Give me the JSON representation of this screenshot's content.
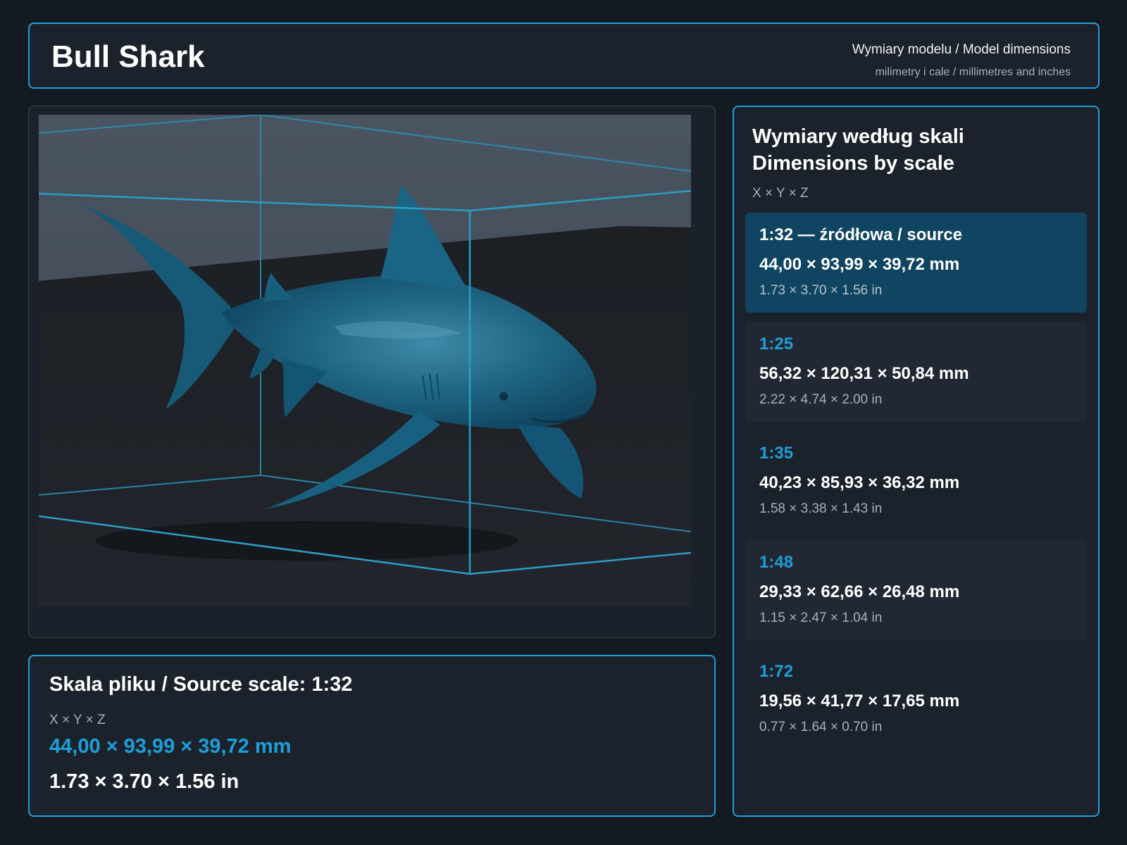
{
  "header": {
    "title": "Bull Shark",
    "subtitle": "Wymiary modelu / Model dimensions",
    "units": "milimetry i cale / millimetres and inches"
  },
  "source_info": {
    "title": "Skala pliku / Source scale: 1:32",
    "axis_label": "X × Y × Z",
    "mm": "44,00 × 93,99 × 39,72 mm",
    "inches": "1.73 × 3.70 × 1.56 in"
  },
  "scales_panel": {
    "title_pl": "Wymiary według skali",
    "title_en": "Dimensions by scale",
    "axis_label": "X × Y × Z",
    "items": [
      {
        "label": "1:32  —  źródłowa / source",
        "mm": "44,00 × 93,99 × 39,72 mm",
        "inches": "1.73 × 3.70 × 1.56 in",
        "selected": true
      },
      {
        "label": "1:25",
        "mm": "56,32 × 120,31 × 50,84 mm",
        "inches": "2.22 × 4.74 × 2.00 in",
        "selected": false
      },
      {
        "label": "1:35",
        "mm": "40,23 × 85,93 × 36,32 mm",
        "inches": "1.58 × 3.38 × 1.43 in",
        "selected": false
      },
      {
        "label": "1:48",
        "mm": "29,33 × 62,66 × 26,48 mm",
        "inches": "1.15 × 2.47 × 1.04 in",
        "selected": false
      },
      {
        "label": "1:72",
        "mm": "19,56 × 41,77 × 17,65 mm",
        "inches": "0.77 × 1.64 × 0.70 in",
        "selected": false
      }
    ]
  },
  "colors": {
    "accent": "#1d9fd8",
    "model": "#1b5f7c",
    "selected_card": "#0f4560",
    "background": "#141a22"
  }
}
